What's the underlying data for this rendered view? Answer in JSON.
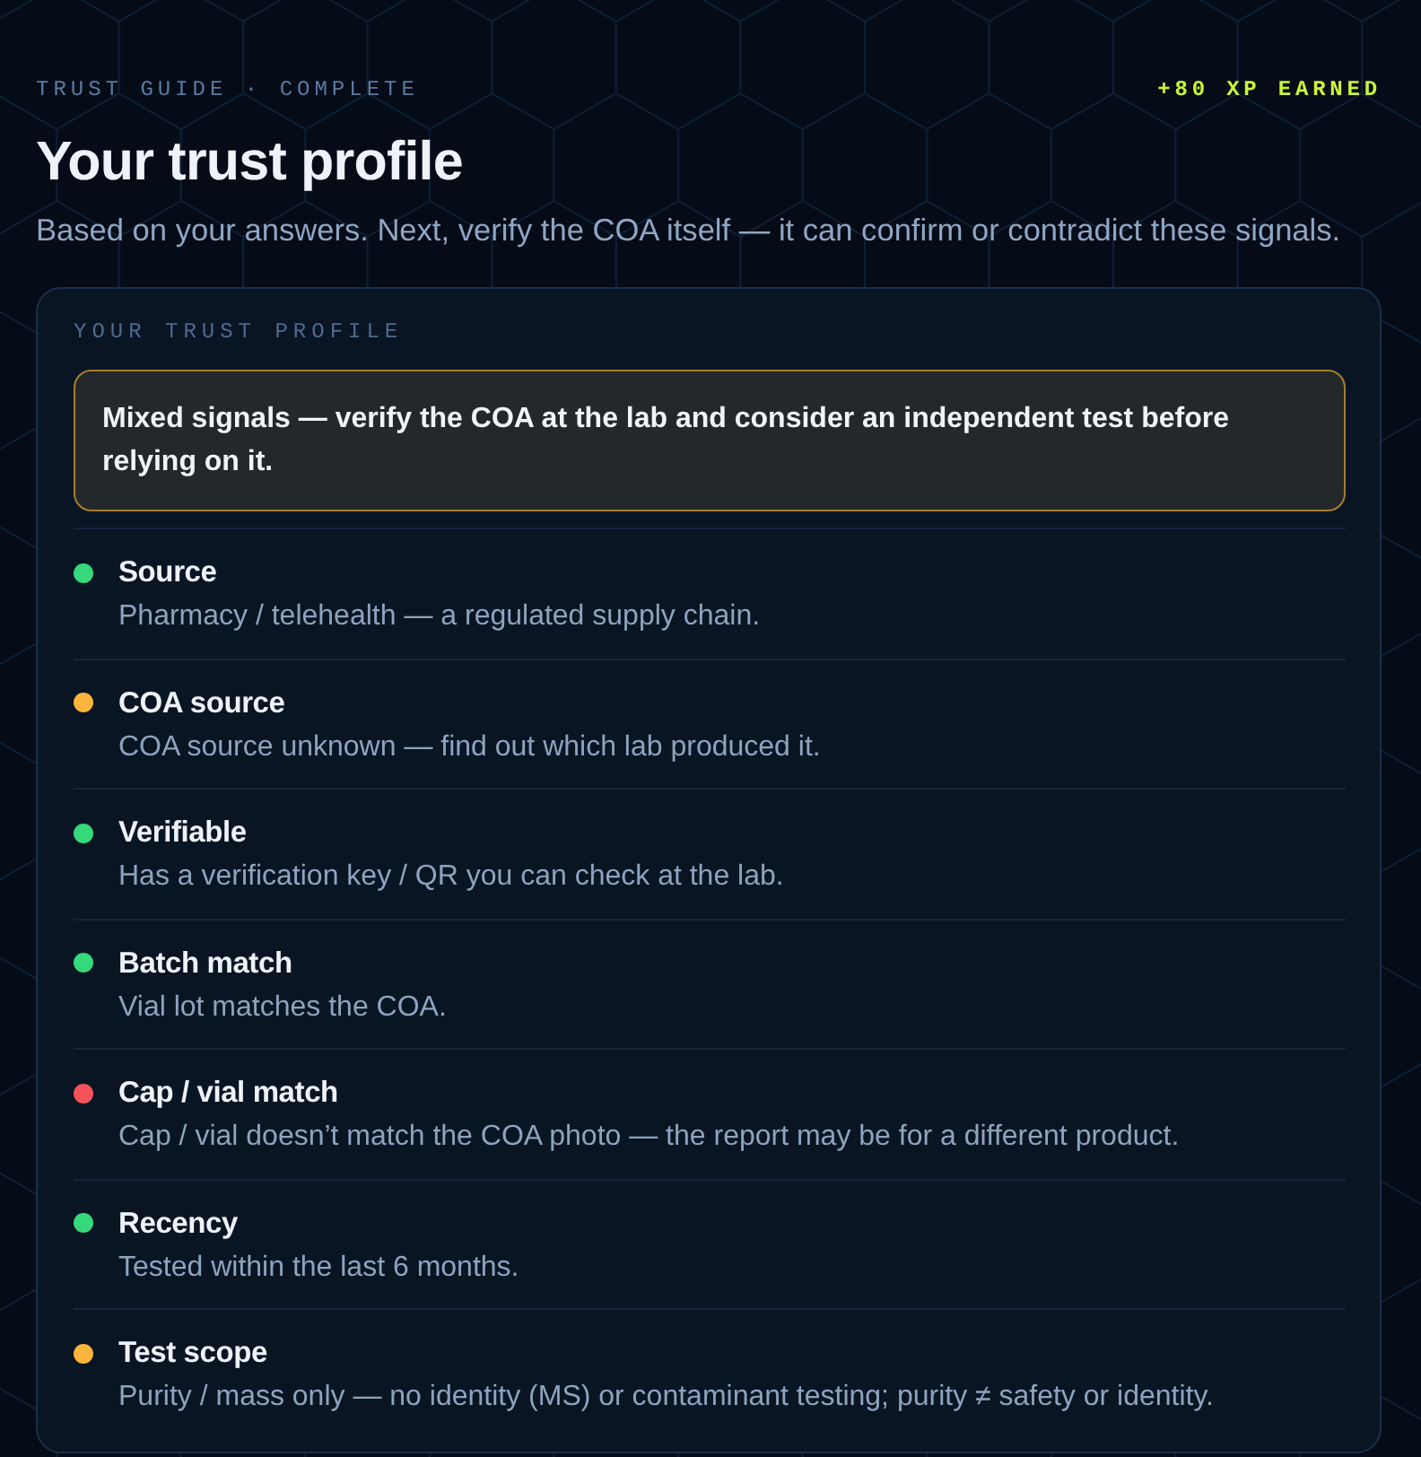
{
  "header": {
    "eyebrow": "TRUST GUIDE · COMPLETE",
    "xp_badge": "+80 XP EARNED",
    "title": "Your trust profile",
    "subtitle": "Based on your answers. Next, verify the COA itself — it can confirm or contradict these signals."
  },
  "profile_card": {
    "heading": "YOUR TRUST PROFILE",
    "verdict": "Mixed signals — verify the COA at the lab and consider an independent test before relying on it.",
    "signals": [
      {
        "name": "Source",
        "detail": "Pharmacy / telehealth — a regulated supply chain.",
        "color": "#35d87a"
      },
      {
        "name": "COA source",
        "detail": "COA source unknown — find out which lab produced it.",
        "color": "#fbb43c"
      },
      {
        "name": "Verifiable",
        "detail": "Has a verification key / QR you can check at the lab.",
        "color": "#35d87a"
      },
      {
        "name": "Batch match",
        "detail": "Vial lot matches the COA.",
        "color": "#35d87a"
      },
      {
        "name": "Cap / vial match",
        "detail": "Cap / vial doesn’t match the COA photo — the report may be for a different product.",
        "color": "#f4535b"
      },
      {
        "name": "Recency",
        "detail": "Tested within the last 6 months.",
        "color": "#35d87a"
      },
      {
        "name": "Test scope",
        "detail": "Purity / mass only — no identity (MS) or contaminant testing; purity ≠ safety or identity.",
        "color": "#fbb43c"
      }
    ]
  }
}
